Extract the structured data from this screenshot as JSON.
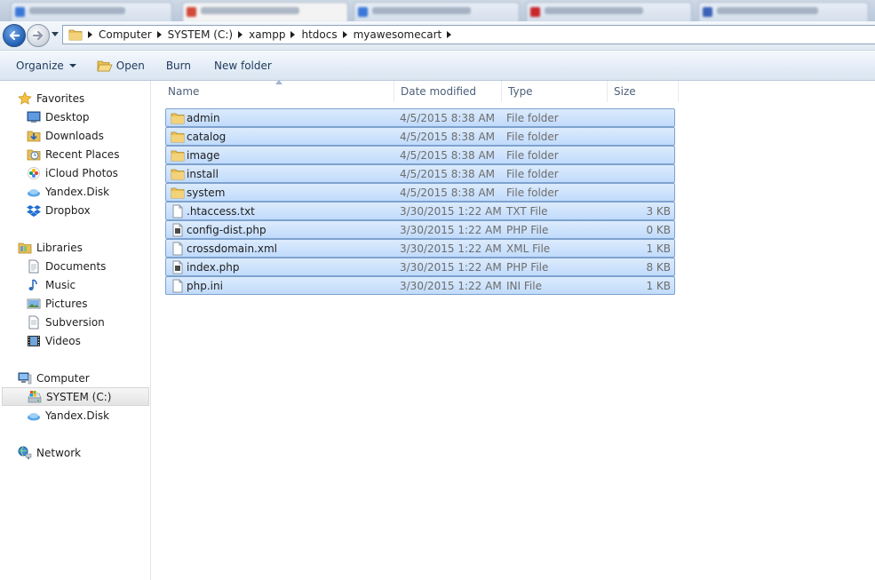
{
  "browser_tabs": [
    {
      "icon_color": "#3a78d8"
    },
    {
      "icon_color": "#d14a3a",
      "active": true
    },
    {
      "icon_color": "#3a78d8"
    },
    {
      "icon_color": "#c8262a"
    },
    {
      "icon_color": "#3b62b8"
    }
  ],
  "address_bar": {
    "crumbs": [
      "Computer",
      "SYSTEM (C:)",
      "xampp",
      "htdocs",
      "myawesomecart"
    ]
  },
  "toolbar": {
    "organize_label": "Organize",
    "open_label": "Open",
    "burn_label": "Burn",
    "new_folder_label": "New folder"
  },
  "nav": {
    "favorites": {
      "label": "Favorites",
      "items": [
        {
          "label": "Desktop",
          "icon": "desktop-icon"
        },
        {
          "label": "Downloads",
          "icon": "downloads-icon"
        },
        {
          "label": "Recent Places",
          "icon": "recent-places-icon"
        },
        {
          "label": "iCloud Photos",
          "icon": "icloud-photos-icon"
        },
        {
          "label": "Yandex.Disk",
          "icon": "yandex-disk-icon"
        },
        {
          "label": "Dropbox",
          "icon": "dropbox-icon"
        }
      ]
    },
    "libraries": {
      "label": "Libraries",
      "items": [
        {
          "label": "Documents",
          "icon": "documents-icon"
        },
        {
          "label": "Music",
          "icon": "music-icon"
        },
        {
          "label": "Pictures",
          "icon": "pictures-icon"
        },
        {
          "label": "Subversion",
          "icon": "subversion-icon"
        },
        {
          "label": "Videos",
          "icon": "videos-icon"
        }
      ]
    },
    "computer": {
      "label": "Computer",
      "items": [
        {
          "label": "SYSTEM (C:)",
          "icon": "drive-icon",
          "selected": true
        },
        {
          "label": "Yandex.Disk",
          "icon": "yandex-disk-icon"
        }
      ]
    },
    "network": {
      "label": "Network"
    }
  },
  "columns": {
    "name": "Name",
    "date": "Date modified",
    "type": "Type",
    "size": "Size"
  },
  "files": [
    {
      "name": "admin",
      "date": "4/5/2015 8:38 AM",
      "type": "File folder",
      "size": "",
      "kind": "folder"
    },
    {
      "name": "catalog",
      "date": "4/5/2015 8:38 AM",
      "type": "File folder",
      "size": "",
      "kind": "folder"
    },
    {
      "name": "image",
      "date": "4/5/2015 8:38 AM",
      "type": "File folder",
      "size": "",
      "kind": "folder"
    },
    {
      "name": "install",
      "date": "4/5/2015 8:38 AM",
      "type": "File folder",
      "size": "",
      "kind": "folder"
    },
    {
      "name": "system",
      "date": "4/5/2015 8:38 AM",
      "type": "File folder",
      "size": "",
      "kind": "folder"
    },
    {
      "name": ".htaccess.txt",
      "date": "3/30/2015 1:22 AM",
      "type": "TXT File",
      "size": "3 KB",
      "kind": "text"
    },
    {
      "name": "config-dist.php",
      "date": "3/30/2015 1:22 AM",
      "type": "PHP File",
      "size": "0 KB",
      "kind": "php"
    },
    {
      "name": "crossdomain.xml",
      "date": "3/30/2015 1:22 AM",
      "type": "XML File",
      "size": "1 KB",
      "kind": "text"
    },
    {
      "name": "index.php",
      "date": "3/30/2015 1:22 AM",
      "type": "PHP File",
      "size": "8 KB",
      "kind": "php"
    },
    {
      "name": "php.ini",
      "date": "3/30/2015 1:22 AM",
      "type": "INI File",
      "size": "1 KB",
      "kind": "text"
    }
  ],
  "colors": {
    "selection_fill": "#c9e0fc",
    "selection_border": "#7da2ce",
    "folder": "#e8c055"
  }
}
